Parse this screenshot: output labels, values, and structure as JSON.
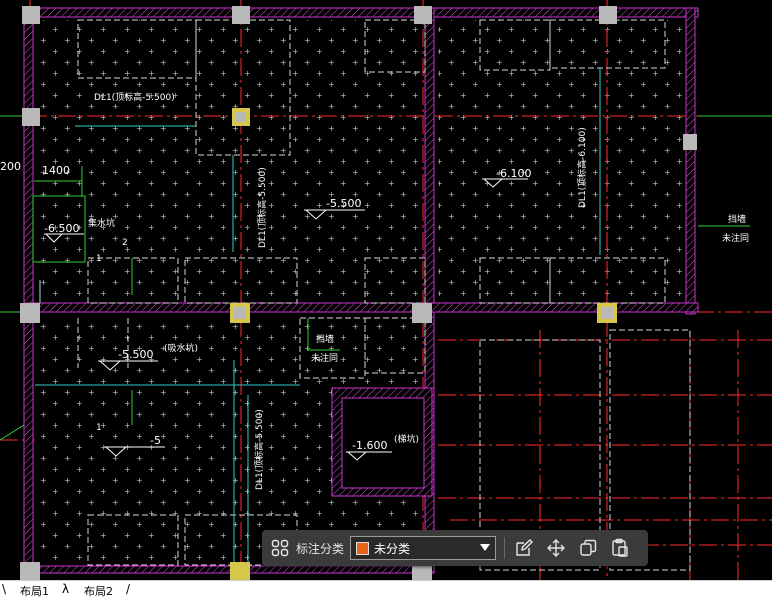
{
  "drawing": {
    "labels": {
      "dl_top": "DL1(顶标高-5.500)",
      "dim_1400": "1400",
      "dim_200": "200",
      "level_sump": "-6.500",
      "sump_name": "集水坑",
      "num_1a": "1",
      "num_2": "2",
      "level_mid": "-5.500",
      "dl_vertical_left": "DL1(顶标高-5.500)",
      "level_right": "-6.100",
      "dl_vertical_right": "DL1(顶标高-6.100)",
      "wall_note_right_1": "挡墙",
      "wall_note_right_2": "未注同",
      "level_pump": "-5.500",
      "pump_pit_note": "(吸水坑)",
      "wall_note_mid_1": "挡墙",
      "wall_note_mid_2": "未注同",
      "num_1b": "1",
      "level_minus5": "-5",
      "dl_vertical_bottom": "DL1(顶标高-5.500)",
      "level_elevator": "-1.600",
      "elevator_pit_note": "(梯坑)"
    }
  },
  "toolbar": {
    "label": "标注分类",
    "category_value": "未分类",
    "category_color": "#e8641c",
    "icons": [
      "grid-layout-icon",
      "edit-icon",
      "move-icon",
      "copy-icon",
      "paste-icon"
    ]
  },
  "tabs": {
    "left_marker": "\\",
    "items": [
      "布局1",
      "布局2"
    ],
    "separators": [
      "λ",
      "/"
    ]
  },
  "colors": {
    "background": "#000000",
    "wall_magenta": "#cc33cc",
    "axis_red": "#ff2a2a",
    "green": "#33cc33",
    "cyan": "#33cccc",
    "column_gray": "#b8b8b8",
    "column_yellow": "#d6c74a"
  }
}
